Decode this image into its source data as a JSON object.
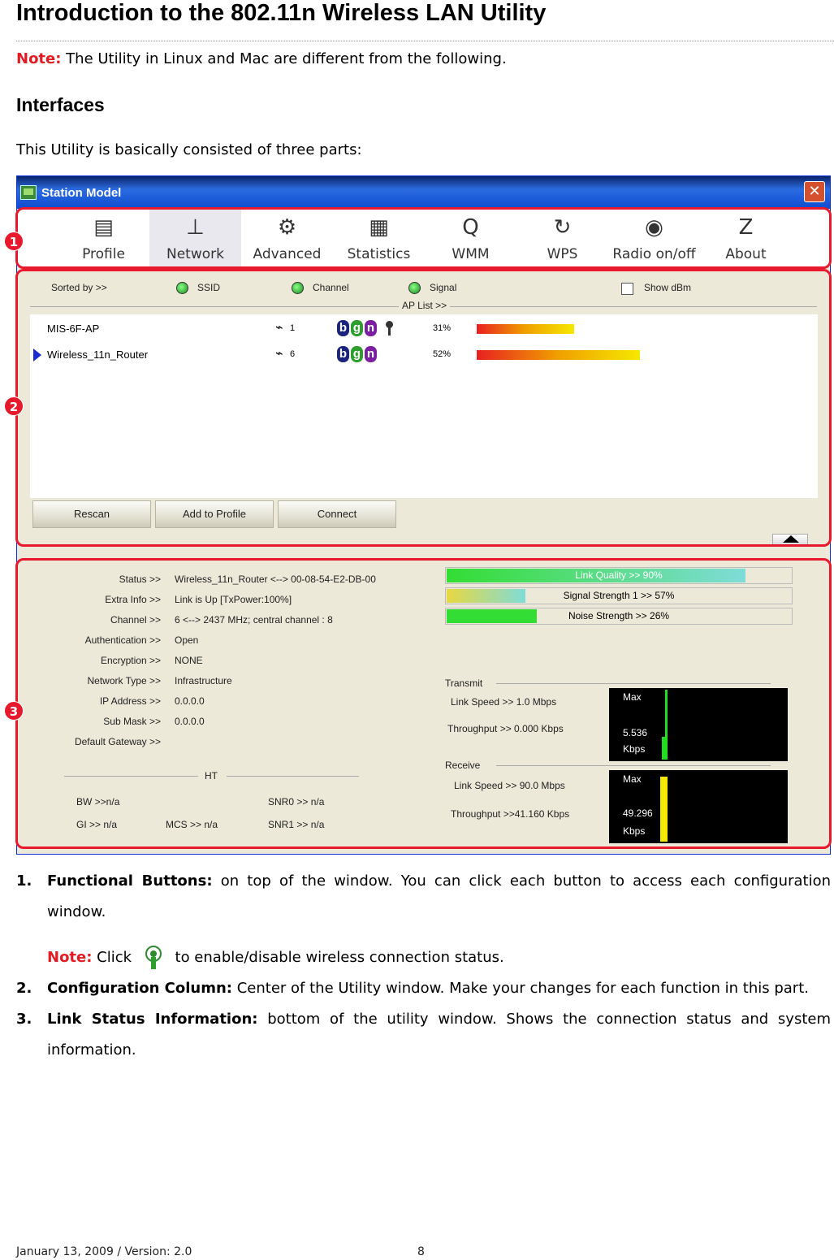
{
  "page": {
    "title": "Introduction to the 802.11n Wireless LAN Utility",
    "note_label": "Note:",
    "note_text": " The Utility in Linux and Mac are different from the following.",
    "heading": "Interfaces",
    "intro": "This Utility is basically consisted of three parts:"
  },
  "window": {
    "title": "Station Model",
    "close_glyph": "✕",
    "nav": [
      {
        "label": "Profile",
        "icon": "notepad-icon",
        "glyph": "▤"
      },
      {
        "label": "Network",
        "icon": "router-icon",
        "glyph": "⊥"
      },
      {
        "label": "Advanced",
        "icon": "gears-icon",
        "glyph": "⚙"
      },
      {
        "label": "Statistics",
        "icon": "calculator-icon",
        "glyph": "▦"
      },
      {
        "label": "WMM",
        "icon": "qos-icon",
        "glyph": "Q"
      },
      {
        "label": "WPS",
        "icon": "wps-icon",
        "glyph": "↻"
      },
      {
        "label": "Radio on/off",
        "icon": "radio-antenna-icon",
        "glyph": "◉"
      },
      {
        "label": "About",
        "icon": "ralink-logo-icon",
        "glyph": "Z"
      }
    ],
    "sort": {
      "sorted_by": "Sorted by >>",
      "ssid": "SSID",
      "channel": "Channel",
      "signal": "Signal",
      "show_dbm": "Show dBm",
      "ap_list": "AP List >>"
    },
    "ap_list": [
      {
        "ssid": "MIS-6F-AP",
        "channel": "1",
        "signal": "31%",
        "signal_pct": 31,
        "secure": true,
        "selected": false
      },
      {
        "ssid": "Wireless_11n_Router",
        "channel": "6",
        "signal": "52%",
        "signal_pct": 52,
        "secure": false,
        "selected": true
      }
    ],
    "badges": [
      "b",
      "g",
      "n"
    ],
    "buttons": {
      "rescan": "Rescan",
      "add_profile": "Add to Profile",
      "connect": "Connect"
    },
    "status": {
      "labels": [
        "Status >>",
        "Extra Info >>",
        "Channel >>",
        "Authentication >>",
        "Encryption >>",
        "Network Type >>",
        "IP Address >>",
        "Sub Mask >>",
        "Default Gateway >>"
      ],
      "values": [
        "Wireless_11n_Router <--> 00-08-54-E2-DB-00",
        "Link is Up [TxPower:100%]",
        "6 <--> 2437 MHz; central channel : 8",
        "Open",
        "NONE",
        "Infrastructure",
        "0.0.0.0",
        "0.0.0.0",
        ""
      ]
    },
    "ht": {
      "title": "HT",
      "bw": "BW >>n/a",
      "gi": "GI >> n/a",
      "mcs": "MCS >>   n/a",
      "snr0": "SNR0 >>  n/a",
      "snr1": "SNR1 >>  n/a"
    },
    "quality": {
      "link": "Link Quality >> 90%",
      "link_pct": 90,
      "strength": "Signal Strength 1 >> 57%",
      "strength_pct": 57,
      "noise": "Noise Strength >> 26%",
      "noise_pct": 26
    },
    "transmit": {
      "title": "Transmit",
      "link_speed": "Link Speed >>  1.0 Mbps",
      "throughput": "Throughput >> 0.000 Kbps",
      "max": "Max",
      "scale": "5.536",
      "unit": "Kbps"
    },
    "receive": {
      "title": "Receive",
      "link_speed": "Link Speed >> 90.0 Mbps",
      "throughput": "Throughput >>41.160 Kbps",
      "max": "Max",
      "scale": "49.296",
      "unit": "Kbps"
    },
    "markers": [
      "1",
      "2",
      "3"
    ]
  },
  "items": [
    {
      "num": "1.",
      "bold": "Functional Buttons:",
      "text": " on top of the window. You can click each button to access each configuration window."
    },
    {
      "num": "2.",
      "bold": "Configuration Column:",
      "text": " Center of the Utility window. Make your changes for each function in this part."
    },
    {
      "num": "3.",
      "bold": "Link Status Information:",
      "text": " bottom of the utility window. Shows the connection status and system information."
    }
  ],
  "sub_note": {
    "label": "Note:",
    "pre": " Click ",
    "post": " to enable/disable wireless connection status."
  },
  "footer": {
    "left": "January 13, 2009 / Version: 2.0",
    "page": "8"
  },
  "colors": {
    "accent_red": "#e31b23",
    "title_bar": "#0e4bd0"
  }
}
